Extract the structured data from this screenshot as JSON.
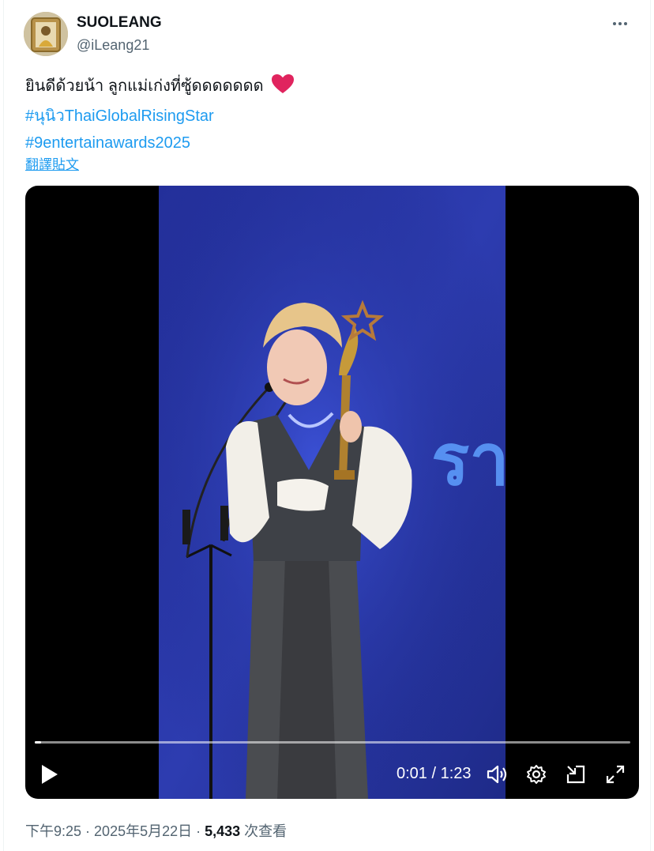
{
  "author": {
    "display_name": "SUOLEANG",
    "handle": "@iLeang21"
  },
  "tweet": {
    "text_line1": "ยินดีด้วยน้า ลูกแม่เก่งที่ซู้ดดดดดดด",
    "emoji": "❤️",
    "hashtag1": "#นุนิวThaiGlobalRisingStar",
    "hashtag2": "#9entertainawards2025",
    "translate_label": "翻譯貼文"
  },
  "video": {
    "time_display": "0:01 / 1:23",
    "progress": 0.01,
    "stage_text": "รา"
  },
  "meta": {
    "time": "下午9:25",
    "sep1": " · ",
    "date": "2025年5月22日",
    "sep2": " · ",
    "views": "5,433",
    "views_label": " 次查看"
  },
  "icons": {
    "more": "more-icon",
    "play": "play-icon",
    "volume": "volume-icon",
    "settings": "settings-icon",
    "pip": "pip-icon",
    "fullscreen": "fullscreen-icon"
  },
  "colors": {
    "link": "#1d9bf0",
    "heart": "#f91880",
    "secondary_text": "#536471"
  }
}
